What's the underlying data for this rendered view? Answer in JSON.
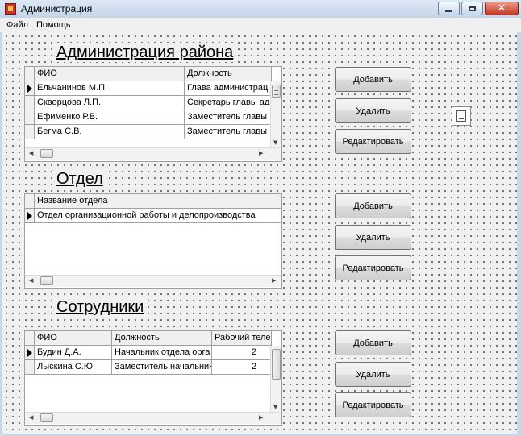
{
  "window": {
    "title": "Администрация",
    "close_glyph": "✕"
  },
  "menu": {
    "items": [
      "Файл",
      "Помощь"
    ]
  },
  "sections": [
    {
      "title": "Администрация района",
      "columns": [
        "ФИО",
        "Должность"
      ],
      "rows": [
        [
          "Ельчанинов М.П.",
          "Глава администрац"
        ],
        [
          "Скворцова Л.П.",
          "Секретарь главы ад"
        ],
        [
          "Ефименко Р.В.",
          "Заместитель главы"
        ],
        [
          "Бегма С.В.",
          "Заместитель главы"
        ]
      ],
      "buttons": {
        "add": "Добавить",
        "delete": "Удалить",
        "edit": "Редактировать"
      }
    },
    {
      "title": "Отдел",
      "columns": [
        "Название отдела"
      ],
      "rows": [
        [
          "Отдел организационной работы и делопроизводства"
        ]
      ],
      "buttons": {
        "add": "Добавить",
        "delete": "Удалить",
        "edit": "Редактировать"
      }
    },
    {
      "title": "Сотрудники",
      "columns": [
        "ФИО",
        "Должность",
        "Рабочий теле"
      ],
      "rows": [
        [
          "Будин Д.А.",
          "Начальник отдела орга",
          "2"
        ],
        [
          "Лыскина С.Ю.",
          "Заместитель начальник",
          "2"
        ]
      ],
      "buttons": {
        "add": "Добавить",
        "delete": "Удалить",
        "edit": "Редактировать"
      }
    }
  ],
  "scroll_glyphs": {
    "up": "▲",
    "down": "▼",
    "left": "◀",
    "right": "▶"
  },
  "icons": [
    "app-icon",
    "minimize-icon",
    "maximize-icon",
    "close-icon",
    "row-selector-arrow-icon",
    "non-visual-component-icon"
  ]
}
